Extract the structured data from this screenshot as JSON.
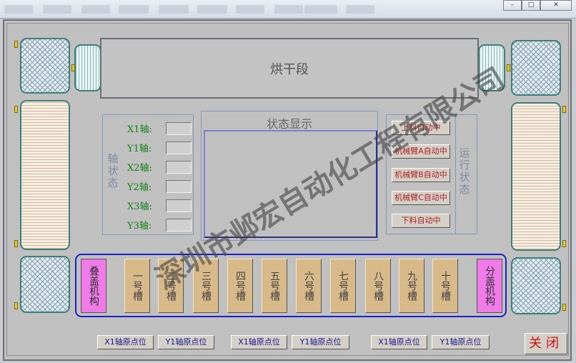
{
  "window": {
    "menu_count": 10,
    "minimize_label": "–",
    "maximize_label": "□",
    "close_label": "✕"
  },
  "drying": {
    "label": "烘干段"
  },
  "axis_panel": {
    "title": "轴状态",
    "axes": [
      "X1轴:",
      "Y1轴:",
      "X2轴:",
      "Y2轴:",
      "X3轴:",
      "Y3轴:"
    ]
  },
  "status": {
    "title": "状态显示"
  },
  "run_panel": {
    "title": "运行状态",
    "buttons": [
      "上料自动中",
      "机械臂A自动中",
      "机械臂B自动中",
      "机械臂C自动中",
      "下料自动中"
    ]
  },
  "mechanisms": {
    "stack": "叠盖机构",
    "split": "分盖机构"
  },
  "tanks": [
    "一号槽",
    "二号槽",
    "三号槽",
    "四号槽",
    "五号槽",
    "六号槽",
    "七号槽",
    "八号槽",
    "九号槽",
    "十号槽"
  ],
  "home_buttons": [
    "X1轴原点位",
    "Y1轴原点位",
    "X1轴原点位",
    "Y1轴原点位",
    "X1轴原点位",
    "Y1轴原点位"
  ],
  "close_label": "关闭",
  "watermark": "深圳市邺宏自动化工程有限公司",
  "colors": {
    "axis_label": "#138013",
    "run_text": "#b02020",
    "tank_fill": "#d8b98a",
    "mech_fill": "#f07ae8",
    "tank_row_border": "#1820c8",
    "close_text": "#d01010"
  }
}
